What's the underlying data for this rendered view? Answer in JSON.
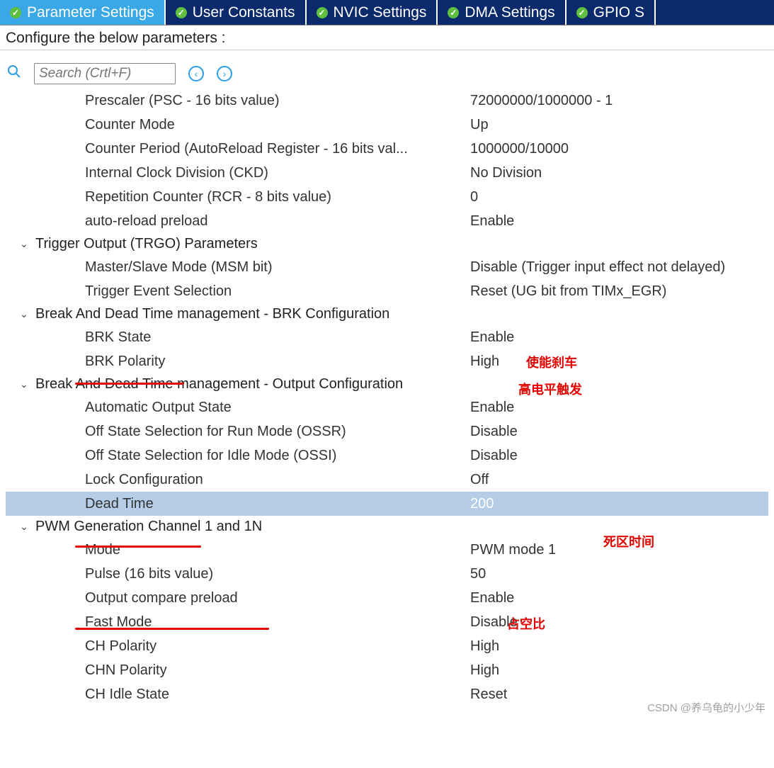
{
  "tabs": [
    {
      "label": "Parameter Settings",
      "active": true
    },
    {
      "label": "User Constants",
      "active": false
    },
    {
      "label": "NVIC Settings",
      "active": false
    },
    {
      "label": "DMA Settings",
      "active": false
    },
    {
      "label": "GPIO S",
      "active": false
    }
  ],
  "subtitle": "Configure the below parameters :",
  "search": {
    "placeholder": "Search (Crtl+F)"
  },
  "groups": [
    {
      "title": null,
      "params": [
        {
          "label": "Prescaler (PSC - 16 bits value)",
          "value": "72000000/1000000 - 1"
        },
        {
          "label": "Counter Mode",
          "value": "Up"
        },
        {
          "label": "Counter Period (AutoReload Register - 16 bits val...",
          "value": "1000000/10000"
        },
        {
          "label": "Internal Clock Division (CKD)",
          "value": "No Division"
        },
        {
          "label": "Repetition Counter (RCR - 8 bits value)",
          "value": "0"
        },
        {
          "label": "auto-reload preload",
          "value": "Enable"
        }
      ]
    },
    {
      "title": "Trigger Output (TRGO) Parameters",
      "params": [
        {
          "label": "Master/Slave Mode (MSM bit)",
          "value": "Disable (Trigger input effect not delayed)"
        },
        {
          "label": "Trigger Event Selection",
          "value": "Reset (UG bit from TIMx_EGR)"
        }
      ]
    },
    {
      "title": "Break And Dead Time management - BRK Configuration",
      "params": [
        {
          "label": "BRK State",
          "value": "Enable"
        },
        {
          "label": "BRK Polarity",
          "value": "High"
        }
      ]
    },
    {
      "title": "Break And Dead Time management - Output Configuration",
      "params": [
        {
          "label": "Automatic Output State",
          "value": "Enable"
        },
        {
          "label": "Off State Selection for Run Mode (OSSR)",
          "value": "Disable"
        },
        {
          "label": "Off State Selection for Idle Mode (OSSI)",
          "value": "Disable"
        },
        {
          "label": "Lock Configuration",
          "value": "Off"
        },
        {
          "label": "Dead Time",
          "value": "200",
          "selected": true
        }
      ]
    },
    {
      "title": "PWM Generation Channel 1 and 1N",
      "params": [
        {
          "label": "Mode",
          "value": "PWM mode 1"
        },
        {
          "label": "Pulse (16 bits value)",
          "value": "50"
        },
        {
          "label": "Output compare preload",
          "value": "Enable"
        },
        {
          "label": "Fast Mode",
          "value": "Disable"
        },
        {
          "label": "CH Polarity",
          "value": "High"
        },
        {
          "label": "CHN Polarity",
          "value": "High"
        },
        {
          "label": "CH Idle State",
          "value": "Reset"
        }
      ]
    }
  ],
  "annotations": {
    "brk_enable": "使能刹车",
    "brk_high": "高电平触发",
    "dead_time": "死区时间",
    "duty_cycle": "占空比"
  },
  "watermark": "CSDN @养乌龟的小少年"
}
